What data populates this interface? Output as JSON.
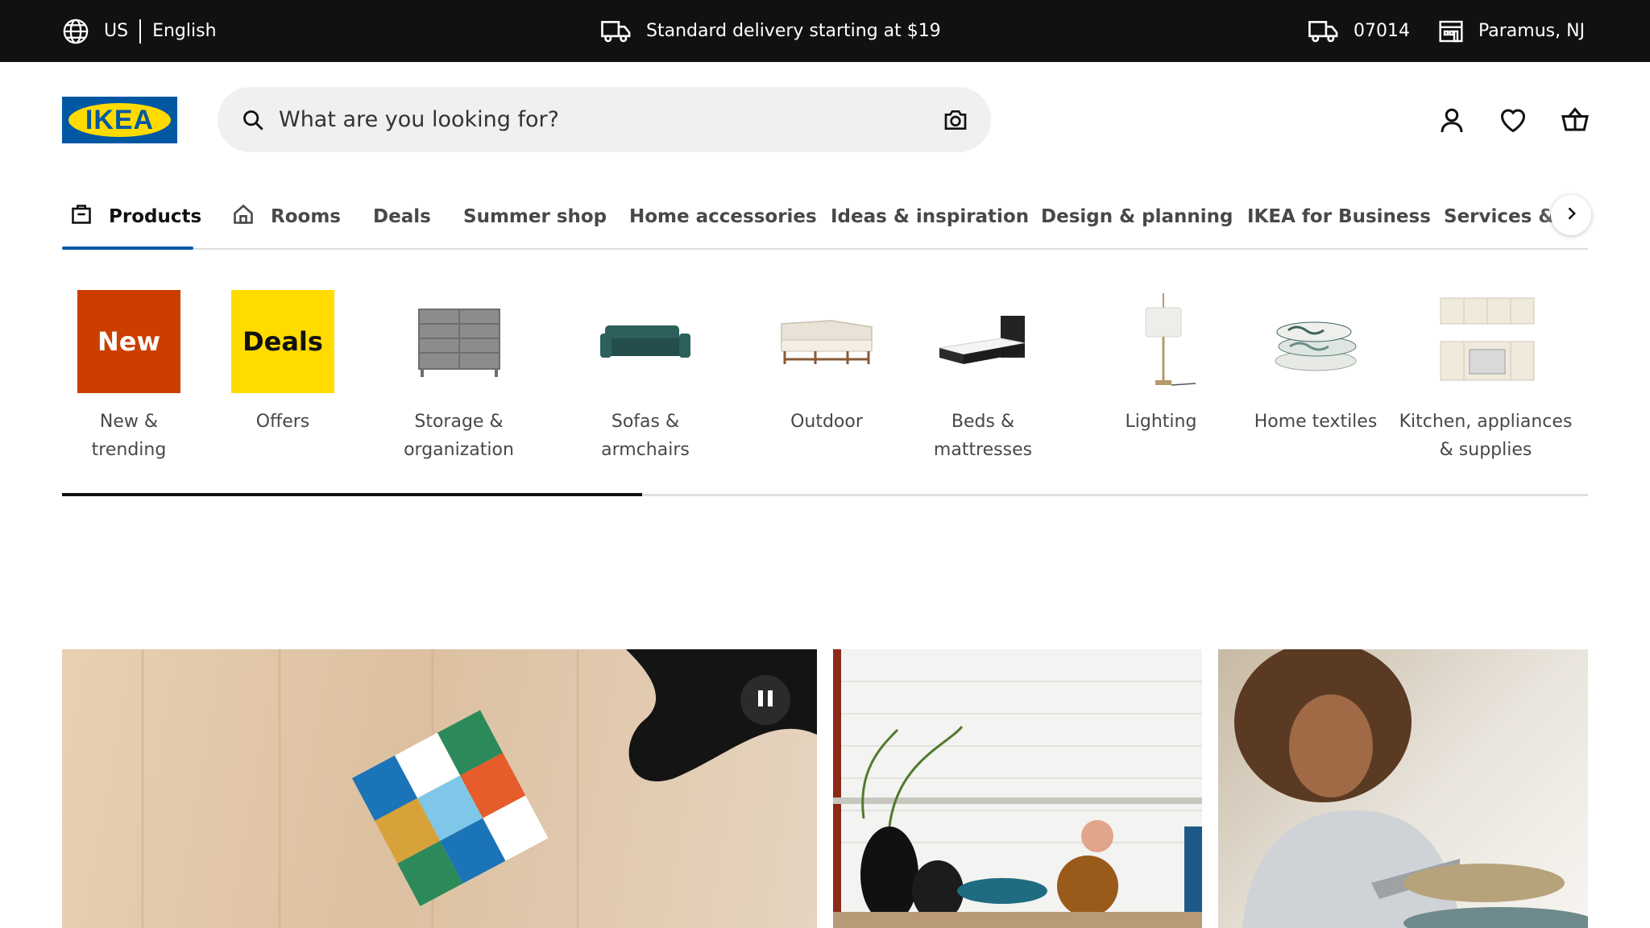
{
  "topbar": {
    "country": "US",
    "language": "English",
    "delivery_text": "Standard delivery starting at $19",
    "zip": "07014",
    "store": "Paramus, NJ"
  },
  "header": {
    "logo_text": "IKEA",
    "search_placeholder": "What are you looking for?"
  },
  "nav": {
    "tabs": [
      {
        "label": "Products",
        "active": true
      },
      {
        "label": "Rooms"
      },
      {
        "label": "Deals"
      },
      {
        "label": "Summer shop"
      },
      {
        "label": "Home accessories"
      },
      {
        "label": "Ideas & inspiration"
      },
      {
        "label": "Design & planning"
      },
      {
        "label": "IKEA for Business"
      },
      {
        "label": "Services & p"
      }
    ]
  },
  "categories": [
    {
      "label": "New & trending",
      "tile_text": "New"
    },
    {
      "label": "Offers",
      "tile_text": "Deals"
    },
    {
      "label_line1": "Storage &",
      "label_line2": "organization"
    },
    {
      "label": "Sofas & armchairs"
    },
    {
      "label": "Outdoor"
    },
    {
      "label": "Beds & mattresses"
    },
    {
      "label": "Lighting"
    },
    {
      "label": "Home textiles"
    },
    {
      "label_line1": "Kitchen, appliances",
      "label_line2": "& supplies"
    }
  ],
  "carousel_progress": 0.38,
  "colors": {
    "brand_blue": "#0058a3",
    "brand_yellow": "#ffdb00",
    "new_tile": "#cc3e00",
    "topbar_bg": "#111111"
  },
  "icons": [
    "globe-icon",
    "truck-icon",
    "store-icon",
    "search-icon",
    "camera-icon",
    "user-icon",
    "heart-icon",
    "basket-icon",
    "shopping-bag-icon",
    "home-icon",
    "chevron-right-icon",
    "pause-icon"
  ]
}
